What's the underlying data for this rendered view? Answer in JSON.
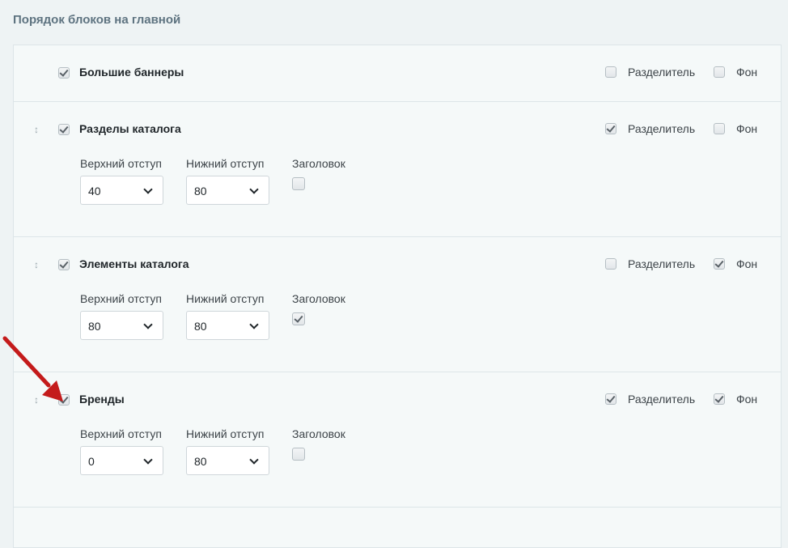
{
  "page": {
    "title": "Порядок блоков на главной"
  },
  "common": {
    "separator_label": "Разделитель",
    "background_label": "Фон",
    "top_padding_label": "Верхний отступ",
    "bottom_padding_label": "Нижний отступ",
    "heading_label": "Заголовок"
  },
  "blocks": [
    {
      "title": "Большие баннеры",
      "enabled": true,
      "separator": false,
      "background": false
    },
    {
      "title": "Разделы каталога",
      "enabled": true,
      "separator": true,
      "background": false,
      "top_padding": "40",
      "bottom_padding": "80",
      "heading": false
    },
    {
      "title": "Элементы каталога",
      "enabled": true,
      "separator": false,
      "background": true,
      "top_padding": "80",
      "bottom_padding": "80",
      "heading": true
    },
    {
      "title": "Бренды",
      "enabled": true,
      "separator": true,
      "background": true,
      "top_padding": "0",
      "bottom_padding": "80",
      "heading": false
    }
  ],
  "annotation": {
    "arrow_color": "#c41b1b"
  },
  "icons": {
    "drag": "drag-handle-icon",
    "check": "checkmark-icon",
    "select": "chevron-down-icon"
  }
}
